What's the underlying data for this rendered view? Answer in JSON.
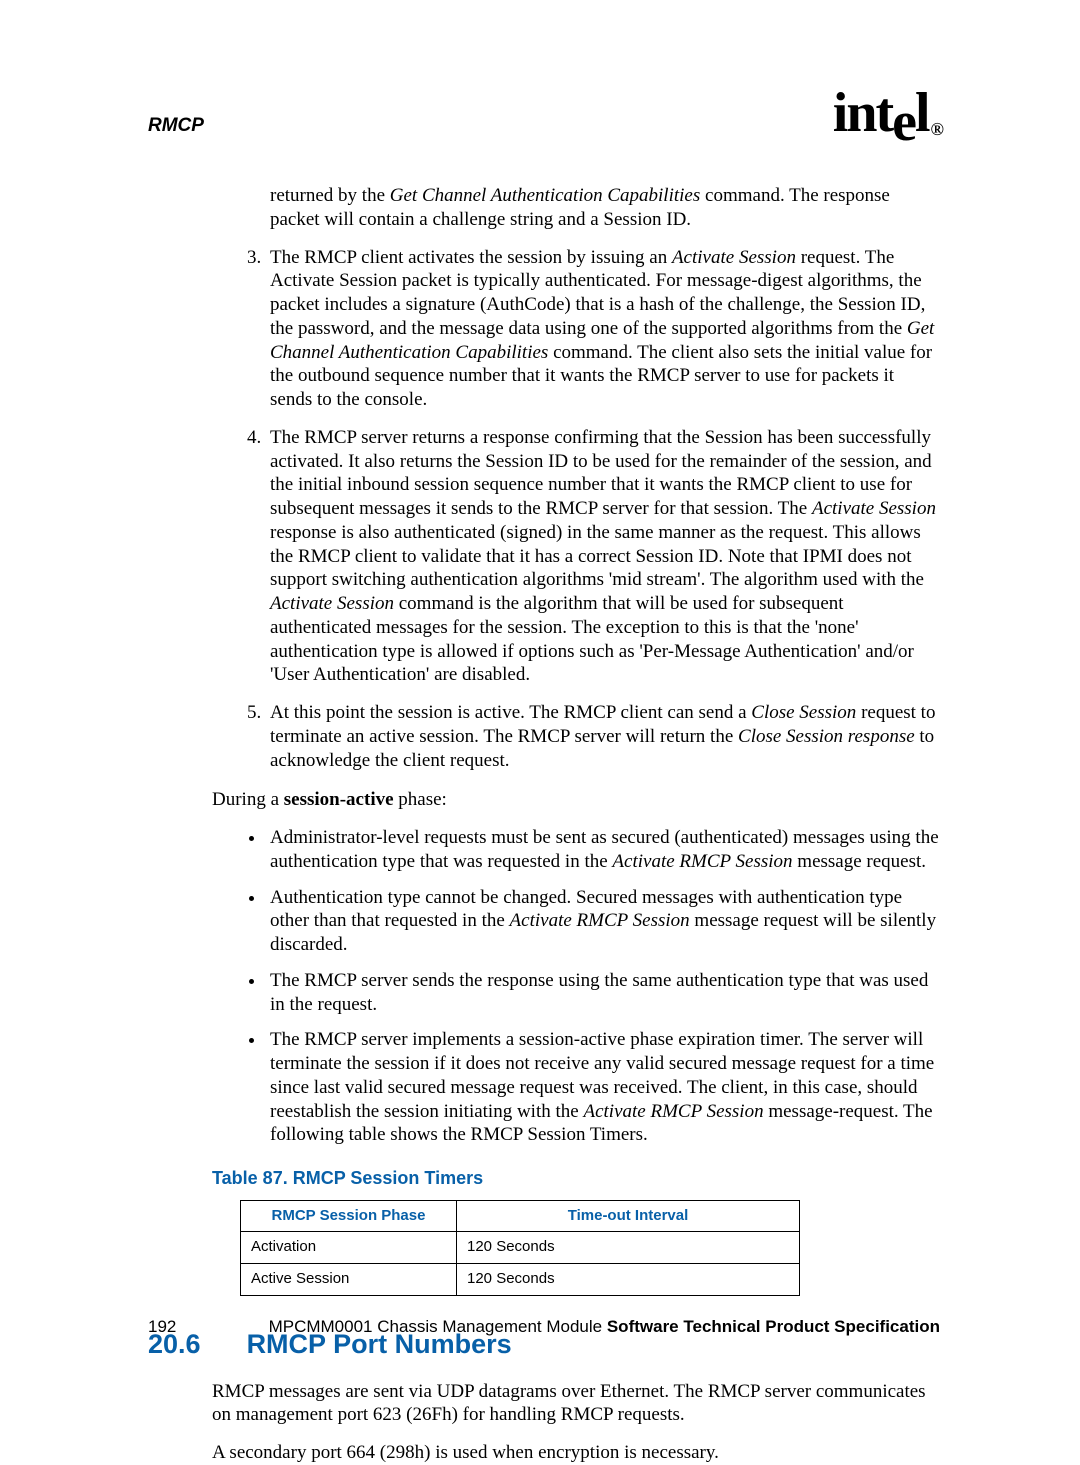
{
  "header": {
    "section_label": "RMCP",
    "logo_text": "intel",
    "logo_sub": "®"
  },
  "intro_para": {
    "pre": "returned by the ",
    "ital1": "Get Channel Authentication Capabilities",
    "post": " command. The response packet will contain a challenge string and a Session ID."
  },
  "num_items": {
    "li3": {
      "t1": "The RMCP client activates the session by issuing an ",
      "i1": "Activate Session",
      "t2": " request. The Activate Session packet is typically authenticated. For message-digest algorithms, the packet includes a signature (AuthCode) that is a hash of the challenge, the Session ID, the password, and the message data using one of the supported algorithms from the ",
      "i2": "Get Channel Authentication Capabilities",
      "t3": " command. The client also sets the initial value for the outbound sequence number that it wants the RMCP server to use for packets it sends to the console."
    },
    "li4": {
      "t1": "The RMCP server returns a response confirming that the Session has been successfully activated. It also returns the Session ID to be used for the remainder of the session, and the initial inbound session sequence number that it wants the RMCP client to use for subsequent messages it sends to the RMCP server for that session. The ",
      "i1": "Activate Session",
      "t2": " response is also authenticated (signed) in the same manner as the request. This allows the RMCP client to validate that it has a correct Session ID. Note that IPMI does not support switching authentication algorithms 'mid stream'. The algorithm used with the ",
      "i2": "Activate Session",
      "t3": " command is the algorithm that will be used for subsequent authenticated messages for the session. The exception to this is that the 'none' authentication type is allowed if options such as 'Per-Message Authentication' and/or 'User Authentication' are disabled."
    },
    "li5": {
      "t1": "At this point the session is active. The RMCP client can send a ",
      "i1": "Close Session",
      "t2": " request to terminate an active session. The RMCP server will return the ",
      "i2": "Close Session response",
      "t3": " to acknowledge the client request."
    }
  },
  "phase_line": {
    "pre": "During a ",
    "bold": "session-active",
    "post": " phase:"
  },
  "bullets": {
    "b1": {
      "t1": "Administrator-level requests must be sent as secured (authenticated) messages using the authentication type that was requested in the ",
      "i1": "Activate RMCP Session",
      "t2": " message request."
    },
    "b2": {
      "t1": "Authentication type cannot be changed. Secured messages with authentication type other than that requested in the ",
      "i1": "Activate RMCP Session",
      "t2": " message request will be silently discarded."
    },
    "b3": "The RMCP server sends the response using the same authentication type that was used in the request.",
    "b4": {
      "t1": "The RMCP server implements a session-active phase expiration timer. The server will terminate the session if it does not receive any valid secured message request for a time since last valid secured message request was received. The client, in this case, should reestablish the session initiating with the ",
      "i1": "Activate RMCP Session",
      "t2": " message-request. The following table shows the RMCP Session Timers."
    }
  },
  "table": {
    "caption": "Table 87.  RMCP Session Timers",
    "headers": [
      "RMCP Session Phase",
      "Time-out Interval"
    ],
    "rows": [
      [
        "Activation",
        "120 Seconds"
      ],
      [
        "Active Session",
        "120 Seconds"
      ]
    ]
  },
  "section": {
    "number": "20.6",
    "title": "RMCP Port Numbers",
    "p1": "RMCP messages are sent via UDP datagrams over Ethernet. The RMCP server communicates on management port 623 (26Fh) for handling RMCP requests.",
    "p2": "A secondary port 664 (298h) is used when encryption is necessary."
  },
  "footer": {
    "page": "192",
    "doc_pre": "MPCMM0001 Chassis Management Module ",
    "doc_bold": "Software Technical Product Specification"
  }
}
